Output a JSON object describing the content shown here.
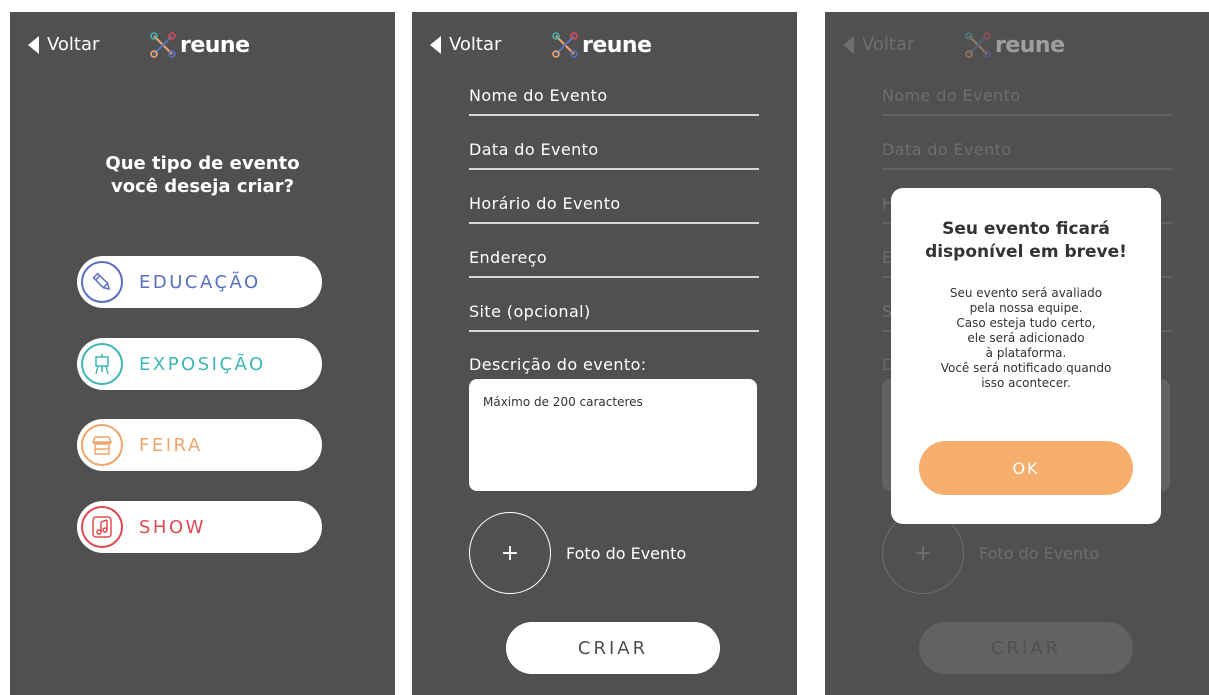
{
  "header": {
    "back_label": "Voltar",
    "logo_text": "reune"
  },
  "screen1": {
    "question_line1": "Que tipo de evento",
    "question_line2": "você deseja criar?",
    "categories": [
      {
        "label": "EDUCAÇÃO",
        "icon": "pencil-icon",
        "color": "#5b6fc2"
      },
      {
        "label": "EXPOSIÇÃO",
        "icon": "easel-icon",
        "color": "#3fb6b4"
      },
      {
        "label": "FEIRA",
        "icon": "market-stall-icon",
        "color": "#f0a66a"
      },
      {
        "label": "SHOW",
        "icon": "music-note-icon",
        "color": "#e04a52"
      }
    ]
  },
  "form": {
    "fields": [
      "Nome do Evento",
      "Data do Evento",
      "Horário do Evento",
      "Endereço",
      "Site (opcional)"
    ],
    "description_label": "Descrição do evento:",
    "description_placeholder": "Máximo de 200 caracteres",
    "photo_plus": "+",
    "photo_label": "Foto do Evento",
    "create_label": "CRIAR"
  },
  "modal": {
    "title": "Seu evento ficará disponível em breve!",
    "body_lines": [
      "Seu evento será avaliado",
      "pela nossa equipe.",
      "Caso esteja tudo certo,",
      "ele será adicionado",
      "à plataforma.",
      "Você será notificado quando",
      "isso acontecer."
    ],
    "ok_label": "OK"
  },
  "colors": {
    "screen_bg": "#505050",
    "ok_button": "#f5ae6b"
  }
}
